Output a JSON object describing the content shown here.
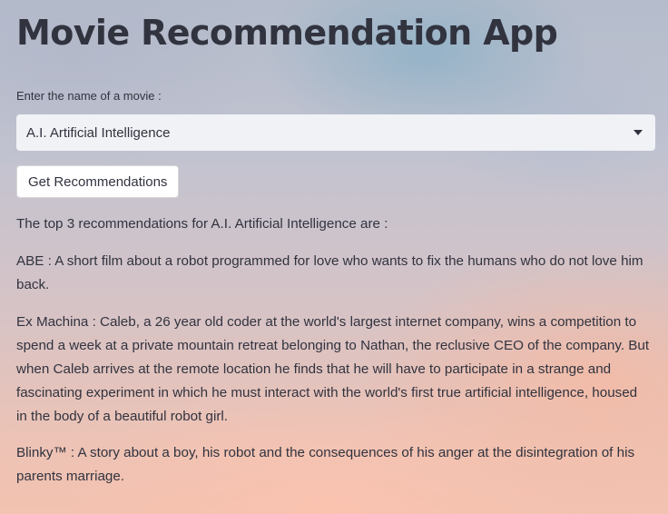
{
  "app": {
    "title": "Movie Recommendation App"
  },
  "movie_select": {
    "label": "Enter the name of a movie :",
    "selected_value": "A.I. Artificial Intelligence"
  },
  "recommend_button": {
    "label": "Get Recommendations"
  },
  "results": {
    "intro": "The top 3 recommendations for A.I. Artificial Intelligence are :",
    "items": [
      "ABE : A short film about a robot programmed for love who wants to fix the humans who do not love him back.",
      "Ex Machina : Caleb, a 26 year old coder at the world's largest internet company, wins a competition to spend a week at a private mountain retreat belonging to Nathan, the reclusive CEO of the company. But when Caleb arrives at the remote location he finds that he will have to participate in a strange and fascinating experiment in which he must interact with the world's first true artificial intelligence, housed in the body of a beautiful robot girl.",
      "Blinky™ : A story about a boy, his robot and the consequences of his anger at the disintegration of his parents marriage."
    ]
  },
  "icons": {
    "dropdown": "chevron-down-icon"
  }
}
